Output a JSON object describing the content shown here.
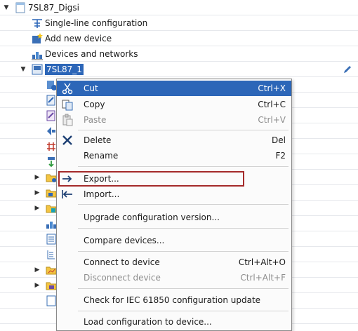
{
  "tree": {
    "project": {
      "label": "7SL87_Digsi",
      "icon": "project-folder-icon"
    },
    "items": [
      {
        "label": "Single-line configuration",
        "icon": "single-line-icon"
      },
      {
        "label": "Add new device",
        "icon": "add-device-icon"
      },
      {
        "label": "Devices and networks",
        "icon": "network-icon"
      }
    ],
    "device": {
      "label": "7SL87_1",
      "icon": "device-icon",
      "edit_icon": "pencil-icon"
    }
  },
  "context_menu": {
    "items": [
      {
        "label": "Cut",
        "shortcut": "Ctrl+X",
        "icon": "scissors-icon",
        "state": "highlighted"
      },
      {
        "label": "Copy",
        "shortcut": "Ctrl+C",
        "icon": "copy-icon",
        "state": "enabled"
      },
      {
        "label": "Paste",
        "shortcut": "Ctrl+V",
        "icon": "paste-icon",
        "state": "disabled"
      },
      {
        "label": "Delete",
        "shortcut": "Del",
        "icon": "delete-x-icon",
        "state": "enabled"
      },
      {
        "label": "Rename",
        "shortcut": "F2",
        "icon": "",
        "state": "enabled"
      },
      {
        "label": "Export...",
        "shortcut": "",
        "icon": "export-arrow-icon",
        "state": "enabled"
      },
      {
        "label": "Import...",
        "shortcut": "",
        "icon": "import-arrow-icon",
        "state": "enabled"
      },
      {
        "label": "Upgrade configuration version...",
        "shortcut": "",
        "icon": "",
        "state": "enabled"
      },
      {
        "label": "Compare devices...",
        "shortcut": "",
        "icon": "",
        "state": "enabled"
      },
      {
        "label": "Connect to device",
        "shortcut": "Ctrl+Alt+O",
        "icon": "",
        "state": "enabled"
      },
      {
        "label": "Disconnect device",
        "shortcut": "Ctrl+Alt+F",
        "icon": "",
        "state": "disabled"
      },
      {
        "label": "Check for IEC 61850 configuration update",
        "shortcut": "",
        "icon": "",
        "state": "enabled"
      },
      {
        "label": "Load configuration to device...",
        "shortcut": "",
        "icon": "",
        "state": "enabled"
      }
    ]
  },
  "colors": {
    "highlight": "#2c66b8",
    "annotation_box": "#a42a2a",
    "disabled_text": "#8c8c8c"
  }
}
